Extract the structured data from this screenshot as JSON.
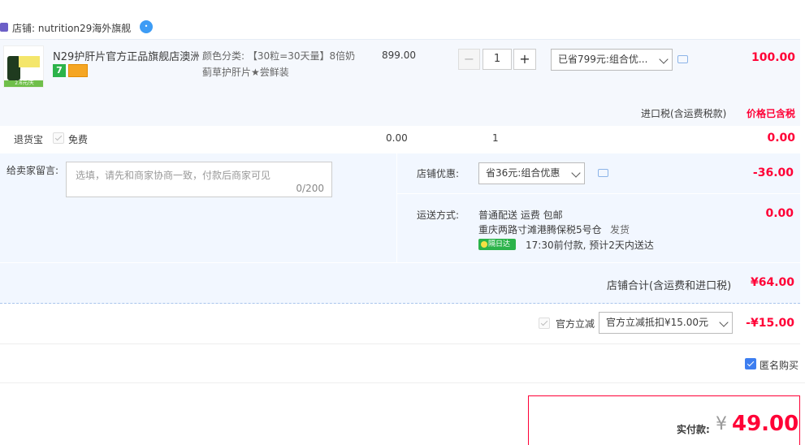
{
  "shop": {
    "label": "店铺: nutrition29海外旗舰",
    "ww_icon": "wangwang-chat-icon"
  },
  "item": {
    "title": "N29护肝片官方正品旗舰店澳洲...",
    "sku_label": "颜色分类:",
    "sku_value": "【30粒=30天量】8倍奶蓟草护肝片★尝鲜装",
    "price": "899.00",
    "quantity": "1",
    "promo_select": "已省799元:组合优...",
    "total": "100.00",
    "badge_7": "7",
    "thumb_caption": "2.6元/天"
  },
  "tax": {
    "label": "进口税(含运费税款)",
    "note": "价格已含税"
  },
  "return_insurance": {
    "label": "退货宝",
    "option": "免费",
    "price": "0.00",
    "qty": "1",
    "total": "0.00"
  },
  "memo": {
    "label": "给卖家留言:",
    "placeholder": "选填，请先和商家协商一致，付款后商家可见",
    "counter": "0/200"
  },
  "shop_discount": {
    "label": "店铺优惠:",
    "select": "省36元:组合优惠",
    "amount": "-36.00"
  },
  "delivery": {
    "label": "运送方式:",
    "line1": "普通配送 运费 包邮",
    "line2_place": "重庆两路寸滩港腾保税5号仓",
    "line2_ship": "发货",
    "badge": "隔日达",
    "eta": "17:30前付款, 预计2天内送达",
    "amount": "0.00"
  },
  "shop_total": {
    "label": "店铺合计(含运费和进口税)",
    "amount": "¥64.00"
  },
  "platform_discount": {
    "label": "官方立减",
    "select": "官方立减抵扣¥15.00元",
    "amount": "-¥15.00"
  },
  "anonymous": {
    "label": "匿名购买"
  },
  "payment": {
    "label": "实付款:",
    "currency": "¥",
    "amount": "49.00"
  }
}
